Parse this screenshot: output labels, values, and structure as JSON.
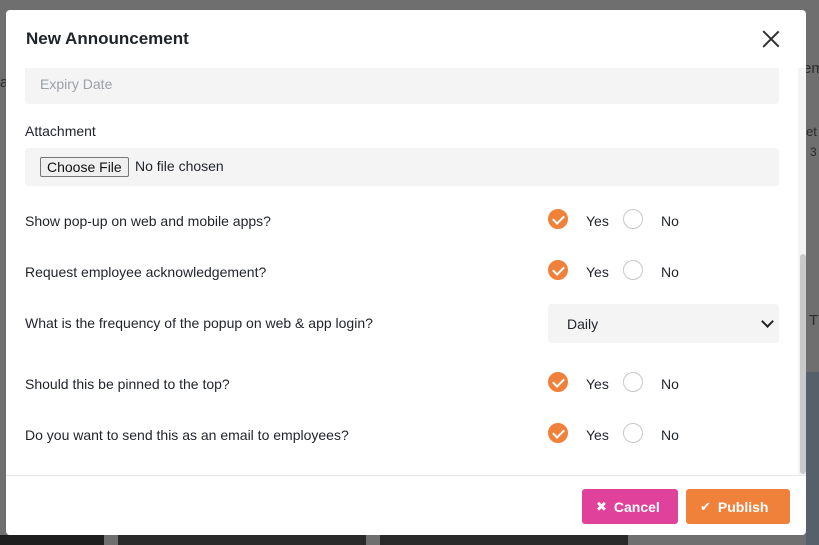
{
  "modal": {
    "title": "New Announcement"
  },
  "form": {
    "expiry_placeholder": "Expiry Date",
    "attachment_label": "Attachment",
    "choose_file_label": "Choose File",
    "no_file_text": "No file chosen",
    "yes_label": "Yes",
    "no_label": "No",
    "questions": [
      {
        "text": "Show pop-up on web and mobile apps?",
        "selected": "Yes"
      },
      {
        "text": "Request employee acknowledgement?",
        "selected": "Yes"
      },
      {
        "text": "What is the frequency of the popup on web & app login?",
        "select_value": "Daily"
      },
      {
        "text": "Should this be pinned to the top?",
        "selected": "Yes"
      },
      {
        "text": "Do you want to send this as an email to employees?",
        "selected": "Yes"
      }
    ]
  },
  "footer": {
    "cancel_label": "Cancel",
    "publish_label": "Publish",
    "cancel_icon": "times-icon",
    "publish_icon": "check-icon"
  },
  "colors": {
    "accent": "#f0813a",
    "cancel": "#e0419a"
  },
  "background": {
    "partial_texts": [
      "em",
      "a",
      "et",
      "3",
      "T"
    ]
  }
}
